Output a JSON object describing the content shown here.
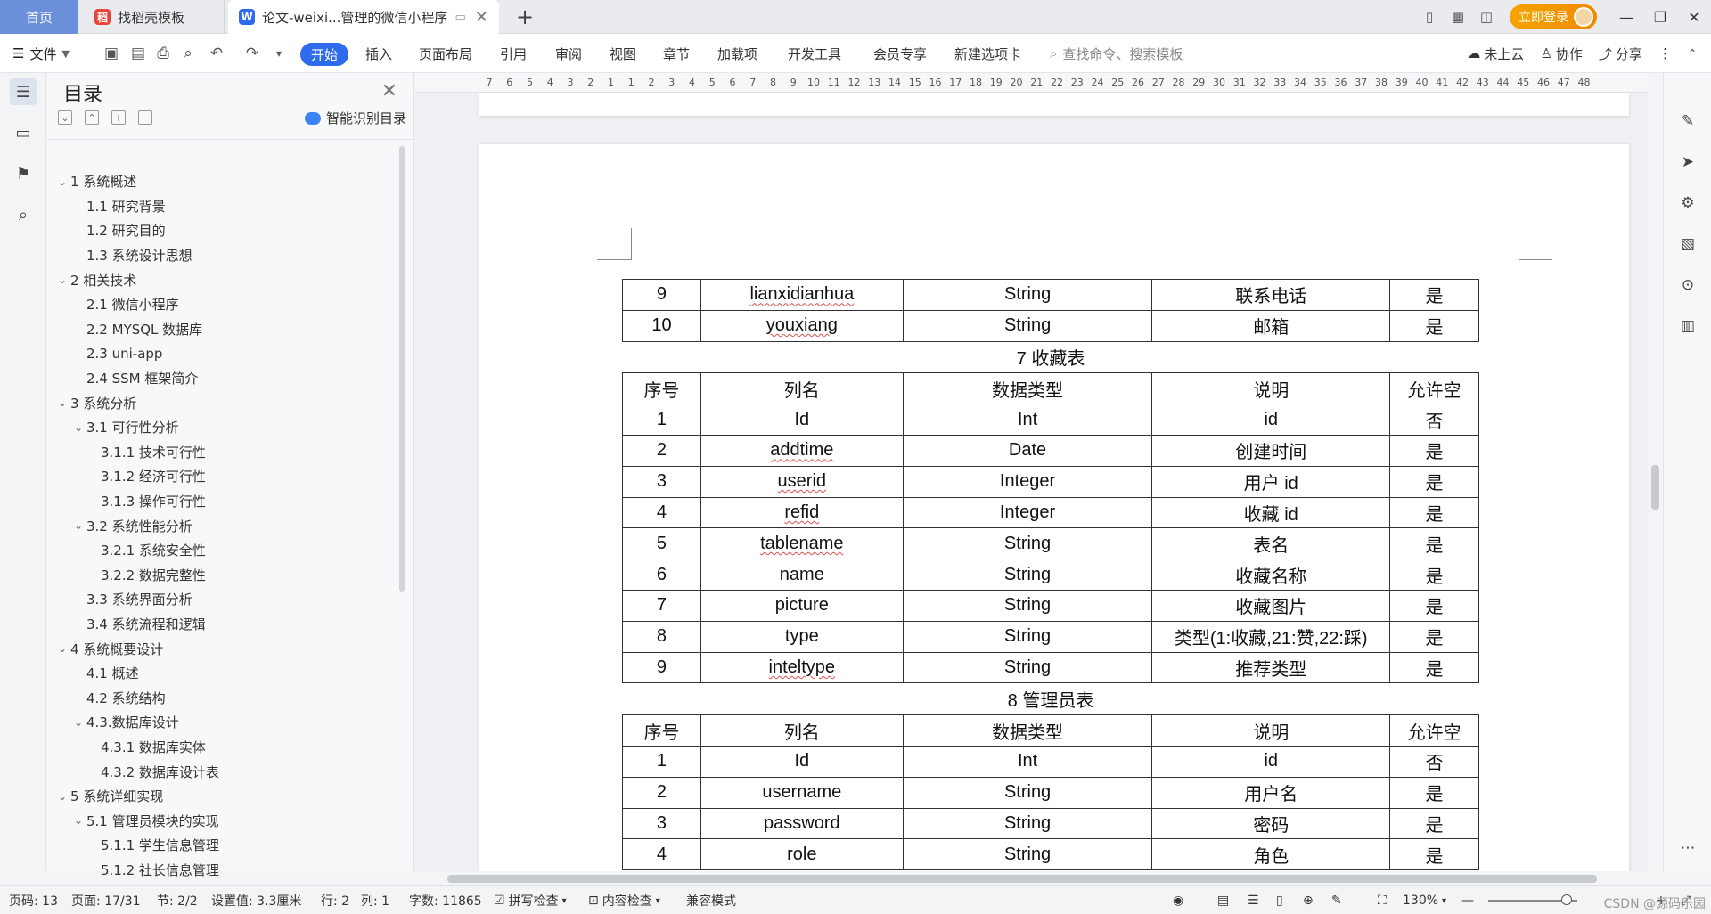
{
  "tabs": {
    "home": "首页",
    "template": "找稻壳模板",
    "document": "论文-weixi...管理的微信小程序"
  },
  "title_right": {
    "login": "立即登录"
  },
  "ribbon": {
    "file": "文件",
    "start": "开始",
    "menus": [
      "插入",
      "页面布局",
      "引用",
      "审阅",
      "视图",
      "章节",
      "加载项",
      "开发工具",
      "会员专享",
      "新建选项卡"
    ],
    "search_placeholder": "查找命令、搜索模板",
    "cloud": "未上云",
    "collab": "协作",
    "share": "分享"
  },
  "toc": {
    "title": "目录",
    "smart": "智能识别目录",
    "items": [
      {
        "text": "1 系统概述",
        "level": 1,
        "expanded": true
      },
      {
        "text": "1.1  研究背景",
        "level": 2
      },
      {
        "text": "1.2 研究目的",
        "level": 2
      },
      {
        "text": "1.3 系统设计思想",
        "level": 2
      },
      {
        "text": "2 相关技术",
        "level": 1,
        "expanded": true
      },
      {
        "text": "2.1 微信小程序",
        "level": 2
      },
      {
        "text": "2.2 MYSQL 数据库",
        "level": 2
      },
      {
        "text": "2.3 uni-app",
        "level": 2
      },
      {
        "text": "2.4 SSM 框架简介",
        "level": 2
      },
      {
        "text": "3 系统分析",
        "level": 1,
        "expanded": true
      },
      {
        "text": "3.1 可行性分析",
        "level": 2,
        "expanded": true
      },
      {
        "text": "3.1.1 技术可行性",
        "level": 3
      },
      {
        "text": "3.1.2 经济可行性",
        "level": 3
      },
      {
        "text": "3.1.3 操作可行性",
        "level": 3
      },
      {
        "text": "3.2 系统性能分析",
        "level": 2,
        "expanded": true
      },
      {
        "text": "3.2.1  系统安全性",
        "level": 3
      },
      {
        "text": "3.2.2  数据完整性",
        "level": 3
      },
      {
        "text": "3.3 系统界面分析",
        "level": 2
      },
      {
        "text": "3.4 系统流程和逻辑",
        "level": 2
      },
      {
        "text": "4 系统概要设计",
        "level": 1,
        "expanded": true
      },
      {
        "text": "4.1 概述",
        "level": 2
      },
      {
        "text": "4.2 系统结构",
        "level": 2
      },
      {
        "text": "4.3.数据库设计",
        "level": 2,
        "expanded": true
      },
      {
        "text": "4.3.1 数据库实体",
        "level": 3
      },
      {
        "text": "4.3.2 数据库设计表",
        "level": 3
      },
      {
        "text": "5 系统详细实现",
        "level": 1,
        "expanded": true
      },
      {
        "text": "5.1  管理员模块的实现",
        "level": 2,
        "expanded": true
      },
      {
        "text": "5.1.1  学生信息管理",
        "level": 3
      },
      {
        "text": "5.1.2  社长信息管理",
        "level": 3
      }
    ]
  },
  "ruler": {
    "ticks": [
      "7",
      "6",
      "5",
      "4",
      "3",
      "2",
      "1",
      "1",
      "2",
      "3",
      "4",
      "5",
      "6",
      "7",
      "8",
      "9",
      "10",
      "11",
      "12",
      "13",
      "14",
      "15",
      "16",
      "17",
      "18",
      "19",
      "20",
      "21",
      "22",
      "23",
      "24",
      "25",
      "26",
      "27",
      "28",
      "29",
      "30",
      "31",
      "32",
      "33",
      "34",
      "35",
      "36",
      "37",
      "38",
      "39",
      "40",
      "41",
      "42",
      "43",
      "44",
      "45",
      "46",
      "47",
      "48"
    ]
  },
  "document": {
    "header_cols": [
      "序号",
      "列名",
      "数据类型",
      "说明",
      "允许空"
    ],
    "table_prev_rows": [
      [
        "9",
        "lianxidianhua",
        "String",
        "联系电话",
        "是"
      ],
      [
        "10",
        "youxiang",
        "String",
        "邮箱",
        "是"
      ]
    ],
    "table7_caption": "7 收藏表",
    "table7_rows": [
      [
        "1",
        "Id",
        "Int",
        "id",
        "否"
      ],
      [
        "2",
        "addtime",
        "Date",
        "创建时间",
        "是"
      ],
      [
        "3",
        "userid",
        "Integer",
        "用户 id",
        "是"
      ],
      [
        "4",
        "refid",
        "Integer",
        "收藏 id",
        "是"
      ],
      [
        "5",
        "tablename",
        "String",
        "表名",
        "是"
      ],
      [
        "6",
        "name",
        "String",
        "收藏名称",
        "是"
      ],
      [
        "7",
        "picture",
        "String",
        "收藏图片",
        "是"
      ],
      [
        "8",
        "type",
        "String",
        "类型(1:收藏,21:赞,22:踩)",
        "是"
      ],
      [
        "9",
        "inteltype",
        "String",
        "推荐类型",
        "是"
      ]
    ],
    "table8_caption": "8 管理员表",
    "table8_rows": [
      [
        "1",
        "Id",
        "Int",
        "id",
        "否"
      ],
      [
        "2",
        "username",
        "String",
        "用户名",
        "是"
      ],
      [
        "3",
        "password",
        "String",
        "密码",
        "是"
      ],
      [
        "4",
        "role",
        "String",
        "角色",
        "是"
      ]
    ]
  },
  "status": {
    "page_code": "页码: 13",
    "pages": "页面: 17/31",
    "section": "节: 2/2",
    "setting": "设置值: 3.3厘米",
    "row": "行: 2",
    "col": "列: 1",
    "words": "字数: 11865",
    "spell": "拼写检查",
    "content_check": "内容检查",
    "compat": "兼容模式",
    "zoom": "130%"
  },
  "watermark": "CSDN @源码乐园"
}
